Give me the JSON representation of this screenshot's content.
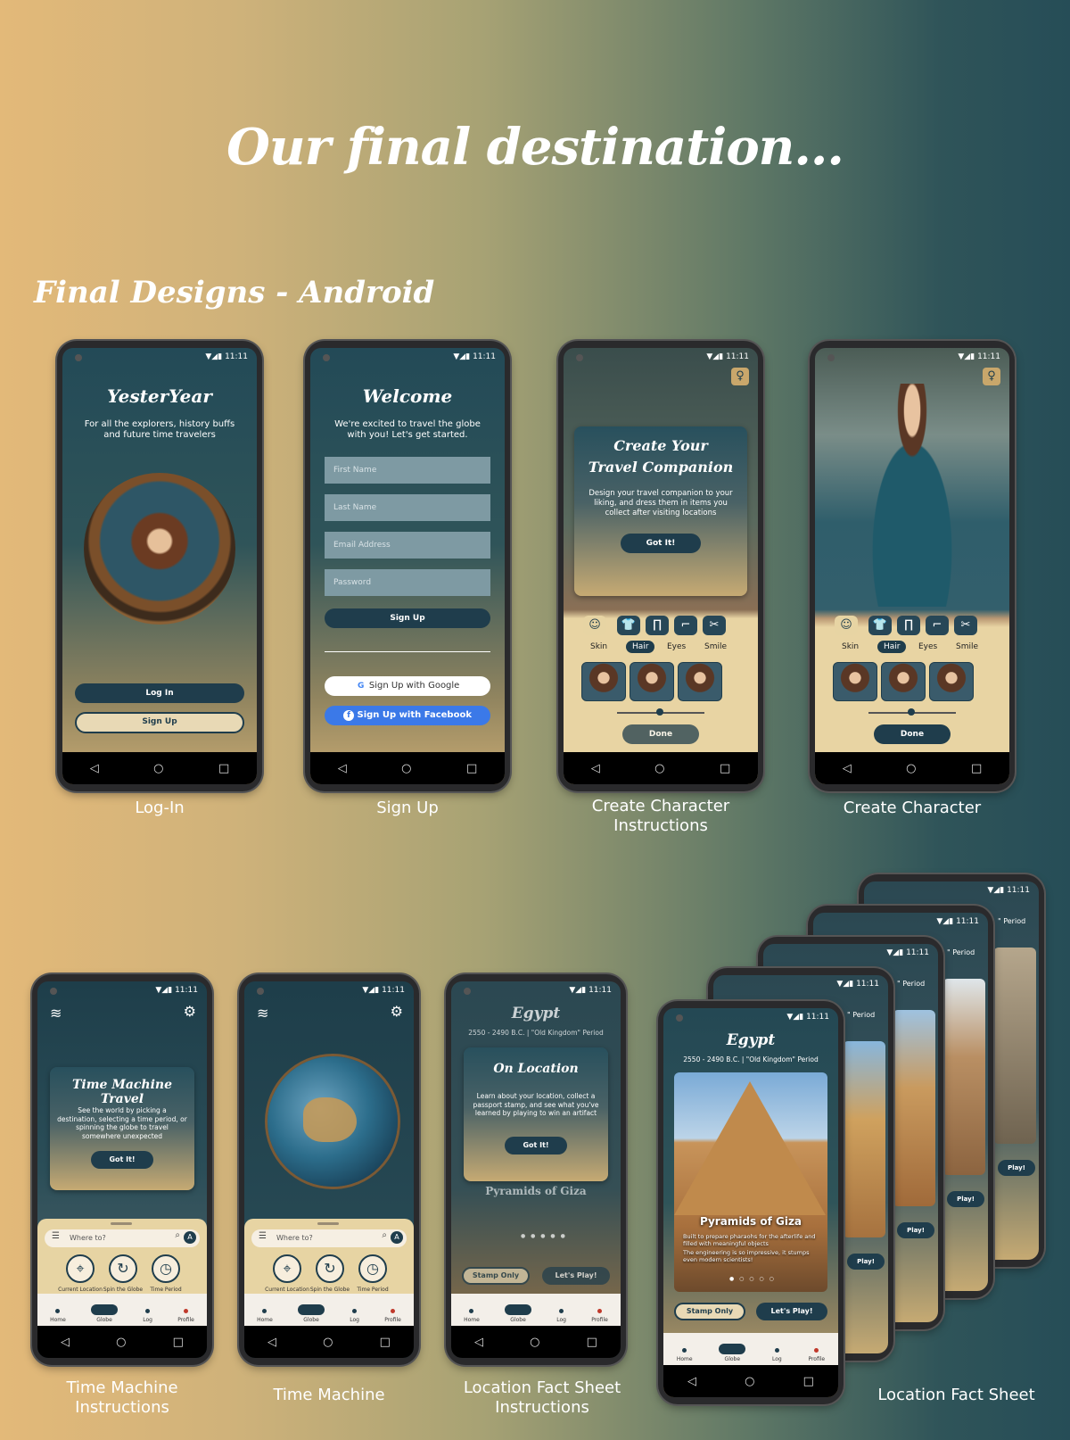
{
  "hero_title": "Our final destination...",
  "section_title": "Final Designs - Android",
  "status": {
    "time": "11:11",
    "icons": "▼◢▮"
  },
  "nav": {
    "back": "◁",
    "home": "○",
    "recent": "□"
  },
  "screens": {
    "login": {
      "caption": "Log-In",
      "title": "YesterYear",
      "tagline": "For all the explorers, history buffs and future time travelers",
      "login_btn": "Log In",
      "signup_btn": "Sign Up"
    },
    "signup": {
      "caption": "Sign Up",
      "title": "Welcome",
      "subtitle": "We're excited to travel the globe with you! Let's get started.",
      "fields": [
        "First Name",
        "Last Name",
        "Email Address",
        "Password"
      ],
      "signup_btn": "Sign Up",
      "google_btn": "Sign Up with Google",
      "facebook_btn": "Sign Up with Facebook"
    },
    "create_instr": {
      "caption": "Create Character Instructions",
      "card_title_1": "Create Your",
      "card_title_2": "Travel Companion",
      "card_text": "Design your travel companion to your liking, and dress them in items you collect after visiting locations",
      "got_it": "Got It!",
      "chips": [
        "Skin",
        "Hair",
        "Eyes",
        "Smile"
      ],
      "done": "Done"
    },
    "create": {
      "caption": "Create Character",
      "chips": [
        "Skin",
        "Hair",
        "Eyes",
        "Smile"
      ],
      "done": "Done"
    },
    "tm_instr": {
      "caption": "Time Machine Instructions",
      "card_title": "Time Machine Travel",
      "card_text": "See the world by picking a destination, selecting a time period, or spinning the globe to travel somewhere unexpected",
      "got_it": "Got It!"
    },
    "tm": {
      "caption": "Time Machine"
    },
    "loc_instr": {
      "caption": "Location Fact Sheet Instructions",
      "title": "Egypt",
      "period": "2550 - 2490 B.C. | \"Old Kingdom\" Period",
      "card_title": "On Location",
      "card_text": "Learn about your location, collect a passport stamp, and see what you've learned by playing to win an artifact",
      "got_it": "Got It!",
      "bg_heading": "Pyramids of Giza",
      "stamp_btn": "Stamp Only",
      "play_btn": "Let's Play!"
    },
    "loc": {
      "caption": "Location Fact Sheet",
      "title": "Egypt",
      "period": "2550 - 2490 B.C. | \"Old Kingdom\" Period",
      "photo_title": "Pyramids of Giza",
      "bullet_1": "Built to prepare pharaohs for the afterlife and filled with meaningful objects",
      "bullet_2": "The engineering is so impressive, it stumps even modern scientists!",
      "stamp_btn": "Stamp Only",
      "play_btn": "Let's Play!",
      "stack_period": "\" Period",
      "stack_play": "Play!"
    }
  },
  "tm_common": {
    "search_placeholder": "Where to?",
    "avatar_letter": "A",
    "actions": [
      "Current Location",
      "Spin the Globe",
      "Time Period"
    ]
  },
  "bottom_nav": [
    "Home",
    "Globe",
    "Log",
    "Profile"
  ]
}
